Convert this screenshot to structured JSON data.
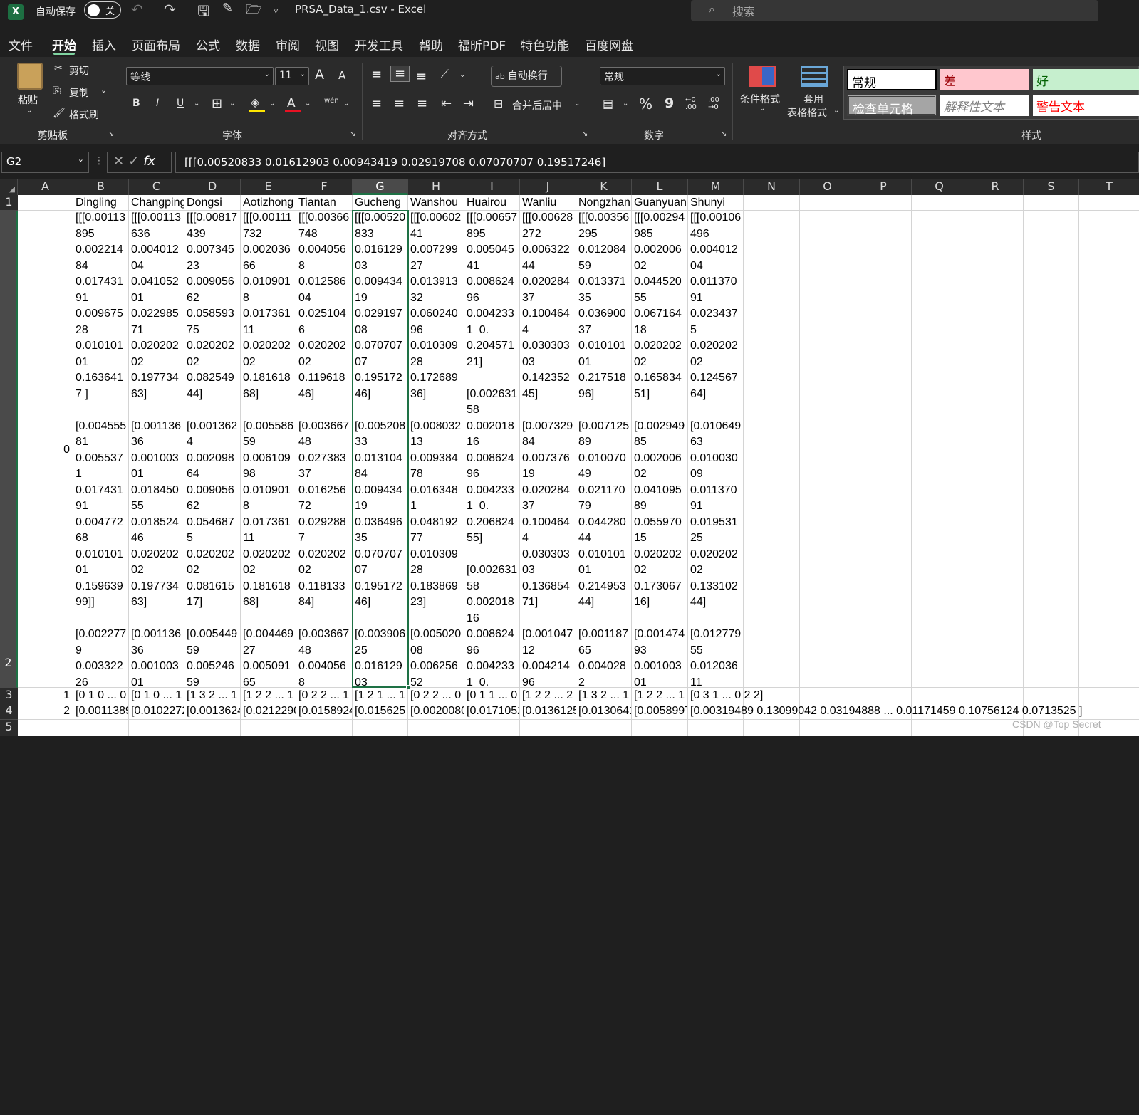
{
  "title_bar": {
    "autosave_label": "自动保存",
    "autosave_state": "关",
    "file_title": "PRSA_Data_1.csv  -  Excel",
    "search_placeholder": "搜索"
  },
  "menu": [
    "文件",
    "开始",
    "插入",
    "页面布局",
    "公式",
    "数据",
    "审阅",
    "视图",
    "开发工具",
    "帮助",
    "福昕PDF",
    "特色功能",
    "百度网盘"
  ],
  "ribbon": {
    "clipboard": {
      "paste": "粘贴",
      "cut": "剪切",
      "copy": "复制",
      "format_painter": "格式刷",
      "group": "剪贴板"
    },
    "font": {
      "name": "等线",
      "size": "11",
      "bold": "B",
      "italic": "I",
      "underline": "U",
      "group": "字体",
      "grow": "A",
      "shrink": "A",
      "phonetic": "wén"
    },
    "align": {
      "wrap": "自动换行",
      "merge": "合并后居中",
      "group": "对齐方式"
    },
    "number": {
      "format": "常规",
      "percent": "%",
      "comma": "9",
      "group": "数字"
    },
    "styles": {
      "cond": "条件格式",
      "table1": "套用",
      "table2": "表格格式",
      "normal": "常规",
      "bad": "差",
      "good": "好",
      "check": "检查单元格",
      "explain": "解释性文本",
      "warn": "警告文本",
      "group": "样式"
    }
  },
  "formula_bar": {
    "name_box": "G2",
    "fx": "fx",
    "content": "[[[0.00520833 0.01612903 0.00943419 0.02919708 0.07070707 0.19517246]"
  },
  "columns": [
    "A",
    "B",
    "C",
    "D",
    "E",
    "F",
    "G",
    "H",
    "I",
    "J",
    "K",
    "L",
    "M",
    "N",
    "O",
    "P",
    "Q",
    "R",
    "S",
    "T"
  ],
  "rows": [
    "1",
    "2",
    "3",
    "4",
    "5"
  ],
  "header_row": [
    "",
    "Dingling",
    "Changping",
    "Dongsi",
    "Aotizhong",
    "Tiantan",
    "Gucheng",
    "Wanshou",
    "Huairou",
    "Wanliu",
    "Nongzhan",
    "Guanyuan",
    "Shunyi"
  ],
  "row2_index": "0",
  "row2_cells": [
    "[[[0.00113\n895\n0.002214\n84\n0.017431\n91\n0.009675\n28\n0.010101\n01\n0.163641\n7 ]\n\n[0.004555\n81\n0.005537\n1\n0.017431\n91\n0.004772\n68\n0.010101\n01\n0.159639\n99]]\n\n[0.002277\n9\n0.003322\n26",
    "[[[0.00113\n636\n0.004012\n04\n0.041052\n01\n0.022985\n71\n0.020202\n02\n0.197734\n63]\n\n[0.001136\n36\n0.001003\n01\n0.018450\n55\n0.018524\n46\n0.020202\n02\n0.197734\n63]\n\n[0.001136\n36\n0.001003\n01",
    "[[[0.00817\n439\n0.007345\n23\n0.009056\n62\n0.058593\n75\n0.020202\n02\n0.082549\n44]\n\n[0.001362\n4\n0.002098\n64\n0.009056\n62\n0.054687\n5\n0.020202\n02\n0.081615\n17]\n\n[0.005449\n59\n0.005246\n59",
    "[[[0.00111\n732\n0.002036\n66\n0.010901\n8\n0.017361\n11\n0.020202\n02\n0.181618\n68]\n\n[0.005586\n59\n0.006109\n98\n0.010901\n8\n0.017361\n11\n0.020202\n02\n0.181618\n68]\n\n[0.004469\n27\n0.005091\n65",
    "[[[0.00366\n748\n0.004056\n8\n0.012586\n04\n0.025104\n6\n0.020202\n02\n0.119618\n46]\n\n[0.003667\n48\n0.027383\n37\n0.016256\n72\n0.029288\n7\n0.020202\n02\n0.118133\n84]\n\n[0.003667\n48\n0.004056\n8",
    "[[[0.00520\n833\n0.016129\n03\n0.009434\n19\n0.029197\n08\n0.070707\n07\n0.195172\n46]\n\n[0.005208\n33\n0.013104\n84\n0.009434\n19\n0.036496\n35\n0.070707\n07\n0.195172\n46]\n\n[0.003906\n25\n0.016129\n03",
    "[[[0.00602\n41\n0.007299\n27\n0.013913\n32\n0.060240\n96\n0.010309\n28\n0.172689\n36]\n\n[0.008032\n13\n0.009384\n78\n0.016348\n1\n0.048192\n77\n0.010309\n28\n0.183869\n23]\n\n[0.005020\n08\n0.006256\n52",
    "[[[0.00657\n895\n0.005045\n41\n0.008624\n96\n0.004233\n1  0.\n0.204571\n21]\n\n[0.002631\n58\n0.002018\n16\n0.008624\n96\n0.004233\n1  0.\n0.206824\n55]\n\n[0.002631\n58\n0.002018\n16\n0.008624\n96\n0.004233\n1  0.",
    "[[[0.00628\n272\n0.006322\n44\n0.020284\n37\n0.100464\n4\n0.030303\n03\n0.142352\n45]\n\n[0.007329\n84\n0.007376\n19\n0.020284\n37\n0.100464\n4\n0.030303\n03\n0.136854\n71]\n\n[0.001047\n12\n0.004214\n96",
    "[[[0.00356\n295\n0.012084\n59\n0.013371\n35\n0.036900\n37\n0.010101\n01\n0.217518\n96]\n\n[0.007125\n89\n0.010070\n49\n0.021170\n79\n0.044280\n44\n0.010101\n01\n0.214953\n44]\n\n[0.001187\n65\n0.004028\n2",
    "[[[0.00294\n985\n0.002006\n02\n0.044520\n55\n0.067164\n18\n0.020202\n02\n0.165834\n51]\n\n[0.002949\n85\n0.002006\n02\n0.041095\n89\n0.055970\n15\n0.020202\n02\n0.173067\n16]\n\n[0.001474\n93\n0.001003\n01",
    "[[[0.00106\n496\n0.004012\n04\n0.011370\n91\n0.023437\n5\n0.020202\n02\n0.124567\n64]\n\n[0.010649\n63\n0.010030\n09\n0.011370\n91\n0.019531\n25\n0.020202\n02\n0.133102\n44]\n\n[0.012779\n55\n0.012036\n11"
  ],
  "row3": [
    "1",
    "[0 1 0 ... 0",
    "[0 1 0 ... 1",
    "[1 3 2 ... 1",
    "[1 2 2 ... 1",
    "[0 2 2 ... 1",
    "[1 2 1 ... 1",
    "[0 2 2 ... 0",
    "[0 1 1 ... 0",
    "[1 2 2 ... 2",
    "[1 3 2 ... 1",
    "[1 2 2 ... 1",
    "[0 3 1 ... 0 2 2]"
  ],
  "row4": [
    "2",
    "[0.0011389",
    "[0.0102272",
    "[0.0013624",
    "[0.0212290",
    "[0.0158924",
    "[0.015625",
    "[0.0020080",
    "[0.0171052",
    "[0.0136125",
    "[0.0130641",
    "[0.0058997",
    "[0.00319489 0.13099042 0.03194888 ... 0.01171459 0.10756124 0.0713525 ]"
  ],
  "watermark": "CSDN @Top Secret"
}
